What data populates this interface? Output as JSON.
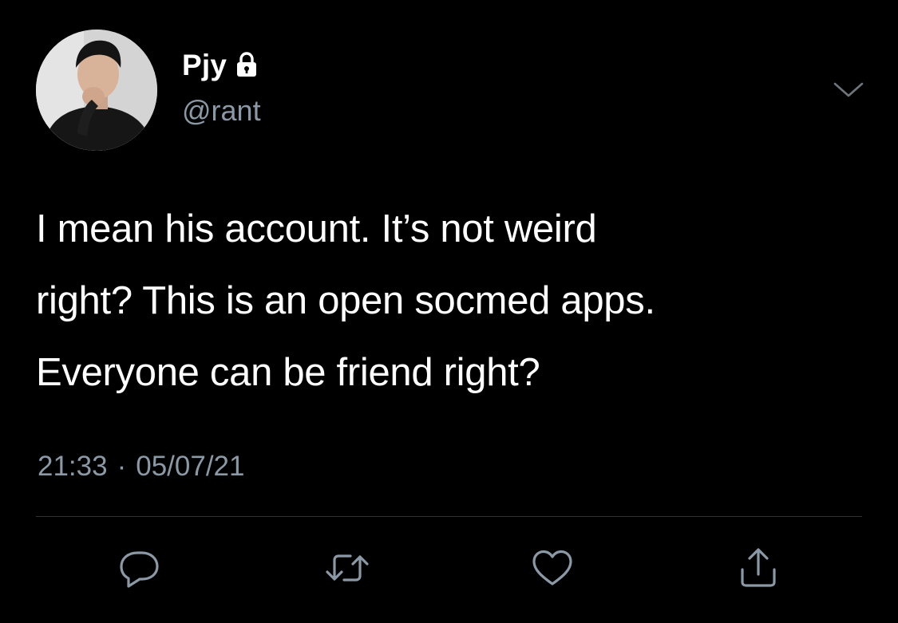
{
  "tweet": {
    "display_name": "Pjy",
    "handle": "@rant",
    "text": "I mean his account. It’s not weird\nright? This is an open socmed apps.\nEveryone can be friend right?",
    "time": "21:33",
    "separator": "·",
    "date": "05/07/21"
  },
  "icons": {
    "lock": "lock-icon",
    "caret": "chevron-down-icon",
    "reply": "reply-icon",
    "retweet": "retweet-icon",
    "like": "heart-icon",
    "share": "share-icon"
  },
  "colors": {
    "background": "#000000",
    "primary_text": "#ffffff",
    "secondary_text": "#8b98a5",
    "divider": "#2f3336"
  }
}
